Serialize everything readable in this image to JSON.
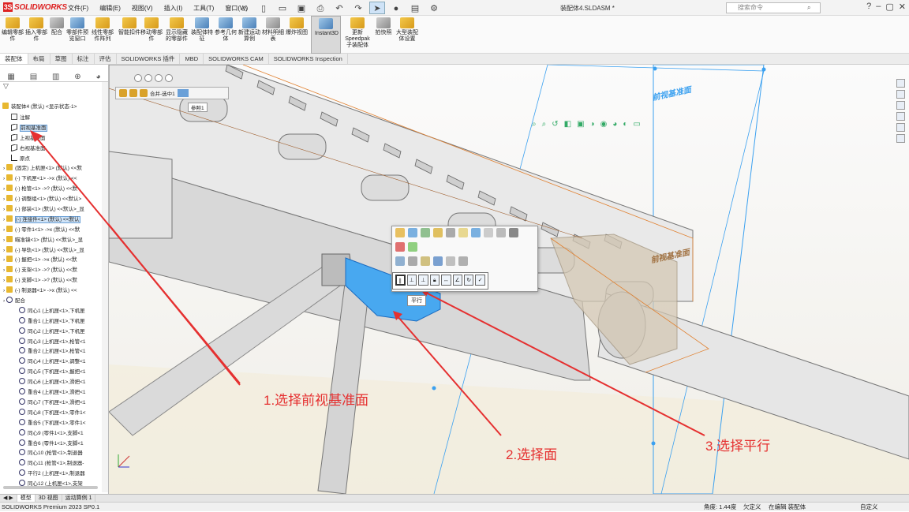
{
  "app": {
    "logo_text": "SOLIDWORKS",
    "menu": [
      "文件(F)",
      "编辑(E)",
      "视图(V)",
      "插入(I)",
      "工具(T)",
      "窗口(W)"
    ],
    "document_title": "装配体4.SLDASM *",
    "search_placeholder": "搜索命令"
  },
  "ribbon": {
    "buttons": [
      {
        "label": "编辑零部件",
        "icon": "edit-component-icon"
      },
      {
        "label": "插入零部件",
        "icon": "insert-component-icon"
      },
      {
        "label": "配合",
        "icon": "mate-icon"
      },
      {
        "label": "零部件预览窗口",
        "icon": "component-preview-icon"
      },
      {
        "label": "线性零部件阵列",
        "icon": "linear-pattern-icon"
      },
      {
        "label": "智能扣件",
        "icon": "smart-fasteners-icon"
      },
      {
        "label": "移动零部件",
        "icon": "move-component-icon"
      },
      {
        "label": "显示隐藏的零部件",
        "icon": "show-hidden-icon"
      },
      {
        "label": "装配体特征",
        "icon": "assembly-features-icon"
      },
      {
        "label": "参考几何体",
        "icon": "reference-geometry-icon"
      },
      {
        "label": "新建运动算例",
        "icon": "new-motion-study-icon"
      },
      {
        "label": "材料明细表",
        "icon": "bom-icon"
      },
      {
        "label": "爆炸视图",
        "icon": "exploded-view-icon"
      },
      {
        "label": "Instant3D",
        "icon": "instant3d-icon"
      },
      {
        "label": "更新Speedpak子装配体",
        "icon": "speedpak-icon"
      },
      {
        "label": "拍快照",
        "icon": "snapshot-icon"
      },
      {
        "label": "大型装配体设置",
        "icon": "large-assembly-icon"
      }
    ]
  },
  "command_tabs": [
    "装配体",
    "布局",
    "草图",
    "标注",
    "评估",
    "SOLIDWORKS 插件",
    "MBD",
    "SOLIDWORKS CAM",
    "SOLIDWORKS Inspection"
  ],
  "tree": {
    "root": "装配体4 (默认) <显示状态-1>",
    "items": [
      {
        "label": "注解",
        "icon": "annotation-icon",
        "indent": 1
      },
      {
        "label": "前视基准面",
        "icon": "plane-icon",
        "indent": 1,
        "selected": true
      },
      {
        "label": "上视基准面",
        "icon": "plane-icon",
        "indent": 1
      },
      {
        "label": "右视基准面",
        "icon": "plane-icon",
        "indent": 1
      },
      {
        "label": "原点",
        "icon": "origin-icon",
        "indent": 1
      },
      {
        "label": "(固定) 上机匣<1> (默认) <<默",
        "icon": "part-icon",
        "indent": 0
      },
      {
        "label": "(-) 下机匣<1> ->x (默认) <<",
        "icon": "part-icon",
        "indent": 0
      },
      {
        "label": "(-) 枪管<1> ->? (默认) <<默",
        "icon": "part-icon",
        "indent": 0
      },
      {
        "label": "(-) 调整组<1> (默认) <<默认>",
        "icon": "part-icon",
        "indent": 0
      },
      {
        "label": "(-) 部装<1> (默认) <<默认>_显",
        "icon": "part-icon",
        "indent": 0
      },
      {
        "label": "(-) 连接件<1> (默认) <<默认",
        "icon": "part-icon",
        "indent": 0,
        "selected": true
      },
      {
        "label": "(-) 零件1<1> ->x (默认) <<默",
        "icon": "part-icon",
        "indent": 0
      },
      {
        "label": "瞄准镜<1> (默认) <<默认>_显",
        "icon": "part-icon",
        "indent": 0
      },
      {
        "label": "(-) 导轨<1> (默认) <<默认>_显",
        "icon": "part-icon",
        "indent": 0
      },
      {
        "label": "(-) 握把<1> ->x (默认) <<默",
        "icon": "part-icon",
        "indent": 0
      },
      {
        "label": "(-) 支架<1> ->? (默认) <<默",
        "icon": "part-icon",
        "indent": 0
      },
      {
        "label": "(-) 支脚<1> ->? (默认) <<默",
        "icon": "part-icon",
        "indent": 0
      },
      {
        "label": "(-) 制退器<1> ->x (默认) <<",
        "icon": "part-icon",
        "indent": 0
      },
      {
        "label": "配合",
        "icon": "mates-folder-icon",
        "indent": 0
      },
      {
        "label": "同心1 (上机匣<1>,下机匣",
        "icon": "concentric-icon",
        "indent": 2
      },
      {
        "label": "重合1 (上机匣<1>,下机匣",
        "icon": "coincident-icon",
        "indent": 2
      },
      {
        "label": "同心2 (上机匣<1>,下机匣",
        "icon": "concentric-icon",
        "indent": 2
      },
      {
        "label": "同心3 (上机匣<1>,枪管<1",
        "icon": "concentric-icon",
        "indent": 2
      },
      {
        "label": "重合2 (上机匣<1>,枪管<1",
        "icon": "coincident-icon",
        "indent": 2
      },
      {
        "label": "同心4 (上机匣<1>,调整<1",
        "icon": "concentric-icon",
        "indent": 2
      },
      {
        "label": "同心5 (下机匣<1>,握把<1",
        "icon": "concentric-icon",
        "indent": 2
      },
      {
        "label": "同心6 (上机匣<1>,滑把<1",
        "icon": "concentric-icon",
        "indent": 2
      },
      {
        "label": "重合4 (上机匣<1>,滑把<1",
        "icon": "coincident-icon",
        "indent": 2
      },
      {
        "label": "同心7 (下机匣<1>,滑把<1",
        "icon": "concentric-icon",
        "indent": 2
      },
      {
        "label": "同心8 (下机匣<1>,零件1<",
        "icon": "concentric-icon",
        "indent": 2
      },
      {
        "label": "重合5 (下机匣<1>,零件1<",
        "icon": "coincident-icon",
        "indent": 2
      },
      {
        "label": "同心9 (零件1<1>,支脚<1",
        "icon": "concentric-icon",
        "indent": 2
      },
      {
        "label": "重合6 (零件1<1>,支脚<1",
        "icon": "coincident-icon",
        "indent": 2
      },
      {
        "label": "同心10 (枪管<1>,制退器",
        "icon": "concentric-icon",
        "indent": 2
      },
      {
        "label": "同心11 (枪管<1>,制退器-",
        "icon": "concentric-icon",
        "indent": 2
      },
      {
        "label": "平行2 (上机匣<1>,制退器",
        "icon": "parallel-icon",
        "indent": 2
      },
      {
        "label": "同心12 (上机匣<1>,支架",
        "icon": "concentric-icon",
        "indent": 2
      }
    ]
  },
  "viewport": {
    "plane_label_front": "前视基准面",
    "plane_label_front_2": "前视基准面",
    "float_toolbar_text": "合并-选中1",
    "float_toolbar_sub": "参照1",
    "tooltip": "平行",
    "annotations": [
      "1.选择前视基准面",
      "2.选择面",
      "3.选择平行"
    ],
    "accent_red": "#e53030",
    "accent_blue": "#3aa0f0"
  },
  "bottom_tabs": [
    "模型",
    "3D 视图",
    "运动算例 1"
  ],
  "status": {
    "product": "SOLIDWORKS Premium 2023 SP0.1",
    "angle": "角度: 1.44度",
    "defined": "欠定义",
    "editing": "在编辑 装配体",
    "custom": "自定义"
  }
}
